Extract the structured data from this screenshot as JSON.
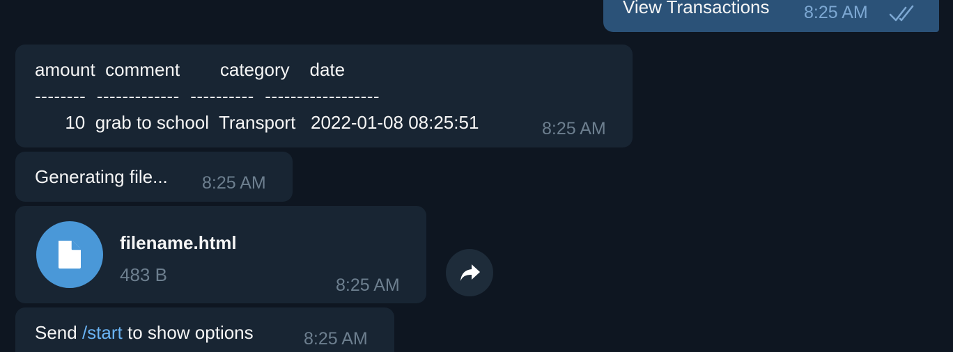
{
  "outgoing": {
    "text": "View Transactions",
    "time": "8:25 AM",
    "status_icon": "double-check-icon"
  },
  "table_message": {
    "header": "amount  comment        category    date",
    "separator": "--------  -------------  ----------  ------------------",
    "row": "      10  grab to school  Transport   2022-01-08 08:25:51",
    "time": "8:25 AM"
  },
  "generating_message": {
    "text": "Generating file...",
    "time": "8:25 AM"
  },
  "file_message": {
    "icon": "document-icon",
    "filename": "filename.html",
    "size": "483 B",
    "time": "8:25 AM"
  },
  "share_button": {
    "icon": "share-arrow-icon"
  },
  "start_message": {
    "prefix": "Send ",
    "command": "/start",
    "suffix": " to show options",
    "time": "8:25 AM"
  },
  "colors": {
    "background": "#0e1621",
    "incoming_bubble": "#182533",
    "outgoing_bubble": "#2b5278",
    "link": "#6ab3f3",
    "file_icon": "#4a98d8"
  }
}
